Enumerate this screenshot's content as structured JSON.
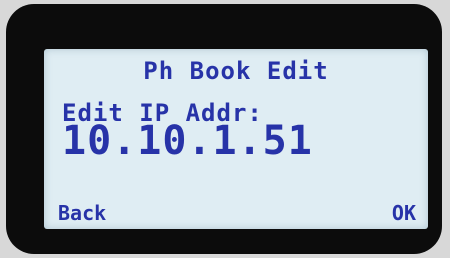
{
  "screen": {
    "title": "Ph Book Edit",
    "field_label": "Edit IP Addr:",
    "field_value": "10.10.1.51"
  },
  "softkeys": {
    "left_label": "Back",
    "right_label": "OK"
  },
  "colors": {
    "lcd_background": "#dfedf3",
    "lcd_text": "#2733a8",
    "bezel": "#0c0c0c"
  }
}
